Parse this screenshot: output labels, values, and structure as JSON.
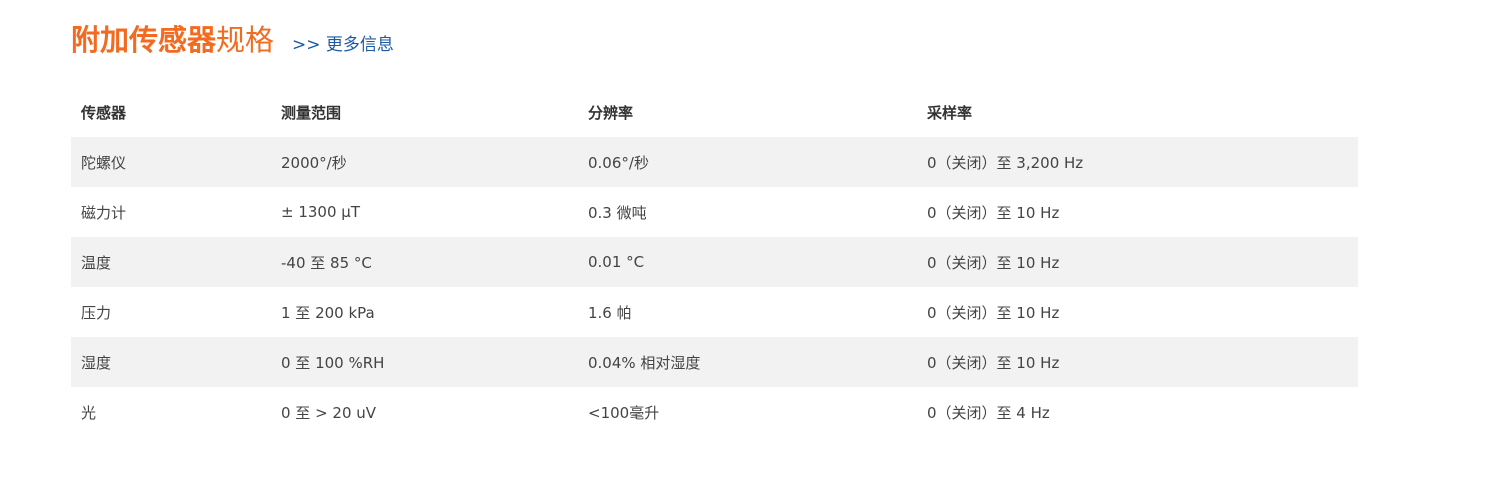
{
  "header": {
    "title_bold": "附加传感器",
    "title_normal": "规格",
    "more_link": ">> 更多信息"
  },
  "colors": {
    "title_accent": "#f26b21",
    "link": "#1a5aa6",
    "row_stripe": "#f2f2f2"
  },
  "table": {
    "columns": [
      "传感器",
      "测量范围",
      "分辨率",
      "采样率"
    ],
    "rows": [
      [
        "陀螺仪",
        "2000°/秒",
        "0.06°/秒",
        "0（关闭）至 3,200 Hz"
      ],
      [
        "磁力计",
        "± 1300 µT",
        "0.3 微吨",
        "0（关闭）至 10 Hz"
      ],
      [
        "温度",
        "-40 至 85 °C",
        "0.01 °C",
        "0（关闭）至 10 Hz"
      ],
      [
        "压力",
        "1 至 200 kPa",
        "1.6 帕",
        "0（关闭）至 10 Hz"
      ],
      [
        "湿度",
        "0 至 100 %RH",
        "0.04% 相对湿度",
        "0（关闭）至 10 Hz"
      ],
      [
        "光",
        "0 至 > 20 uV",
        "<100毫升",
        "0（关闭）至 4 Hz"
      ]
    ]
  }
}
